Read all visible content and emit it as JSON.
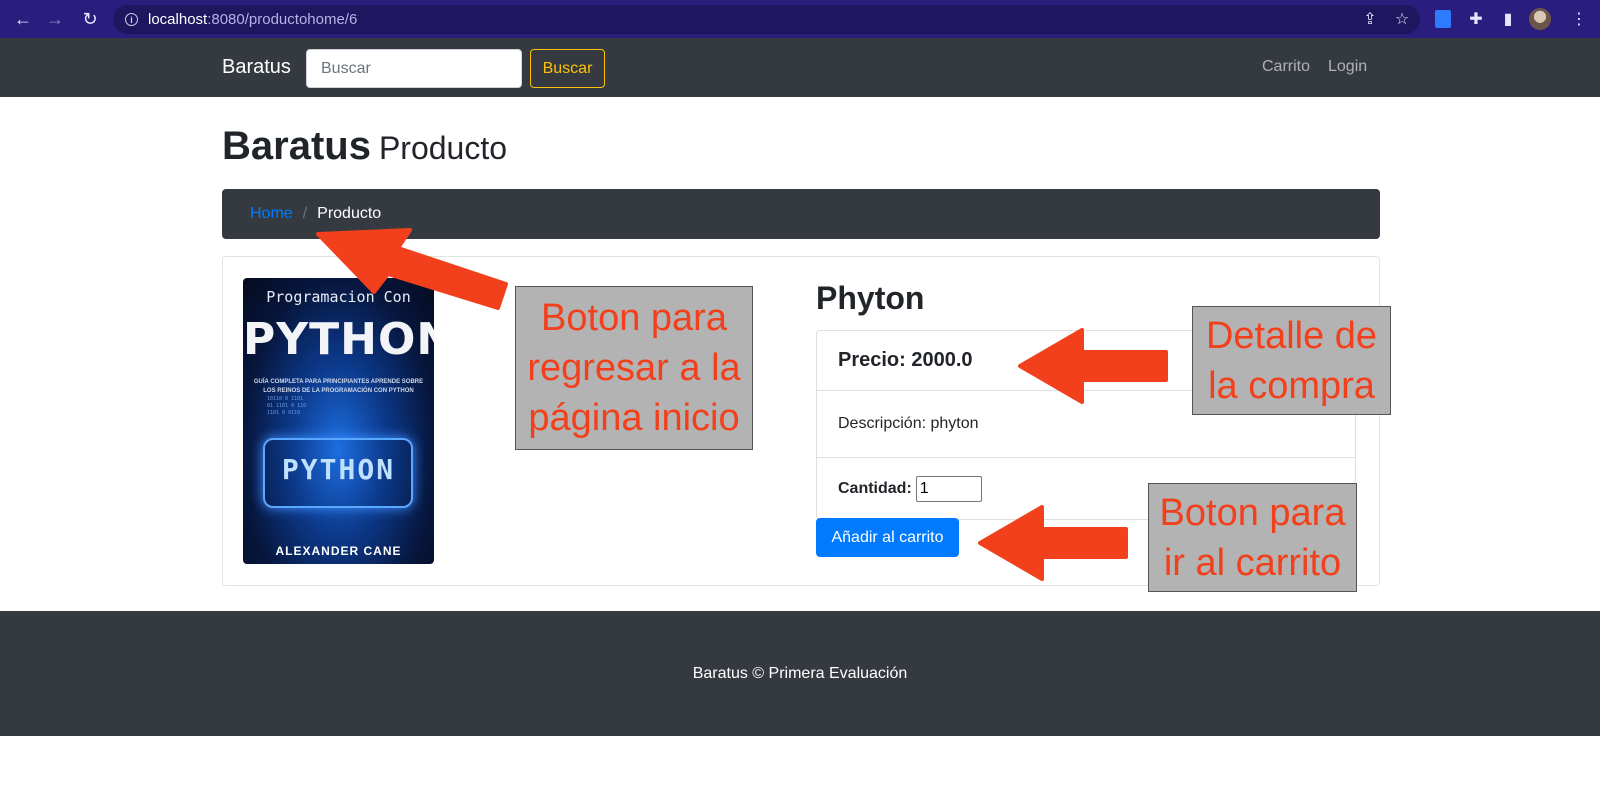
{
  "browser": {
    "url_host": "localhost",
    "url_path": ":8080/productohome/6",
    "icons": [
      "back-icon",
      "forward-icon",
      "reload-icon",
      "info-icon",
      "share-icon",
      "star-icon",
      "extension-icon",
      "puzzle-icon",
      "sidepanel-icon",
      "profile-avatar",
      "menu-icon"
    ]
  },
  "navbar": {
    "brand": "Baratus",
    "search_placeholder": "Buscar",
    "search_button": "Buscar",
    "links": [
      "Carrito",
      "Login"
    ]
  },
  "header": {
    "title": "Baratus",
    "subtitle": "Producto"
  },
  "breadcrumb": {
    "home": "Home",
    "separator": "/",
    "current": "Producto"
  },
  "product": {
    "cover": {
      "line1": "Programacion Con",
      "line2": "PYTHON",
      "line3": "GUÍA COMPLETA PARA PRINCIPIANTES APRENDE SOBRE LOS REINOS DE LA PROGRAMACIÓN CON PYTHON",
      "line4": "PYTHON",
      "author": "ALEXANDER CANE"
    },
    "name": "Phyton",
    "price_text": "Precio: 2000.0",
    "description_text": "Descripción: phyton",
    "quantity_label": "Cantidad:",
    "quantity_value": "1",
    "add_button": "Añadir al carrito"
  },
  "footer": {
    "text": "Baratus © Primera Evaluación"
  },
  "annotations": [
    {
      "text": "Boton para regresar a la página inicio"
    },
    {
      "text": "Detalle de la compra"
    },
    {
      "text": "Boton para ir al carrito"
    }
  ],
  "colors": {
    "navbar_bg": "#343a40",
    "primary": "#007bff",
    "warning": "#ffc107",
    "annotation_text": "#f2401c",
    "annotation_bg": "#b3b3b3",
    "arrow": "#f2401c"
  }
}
